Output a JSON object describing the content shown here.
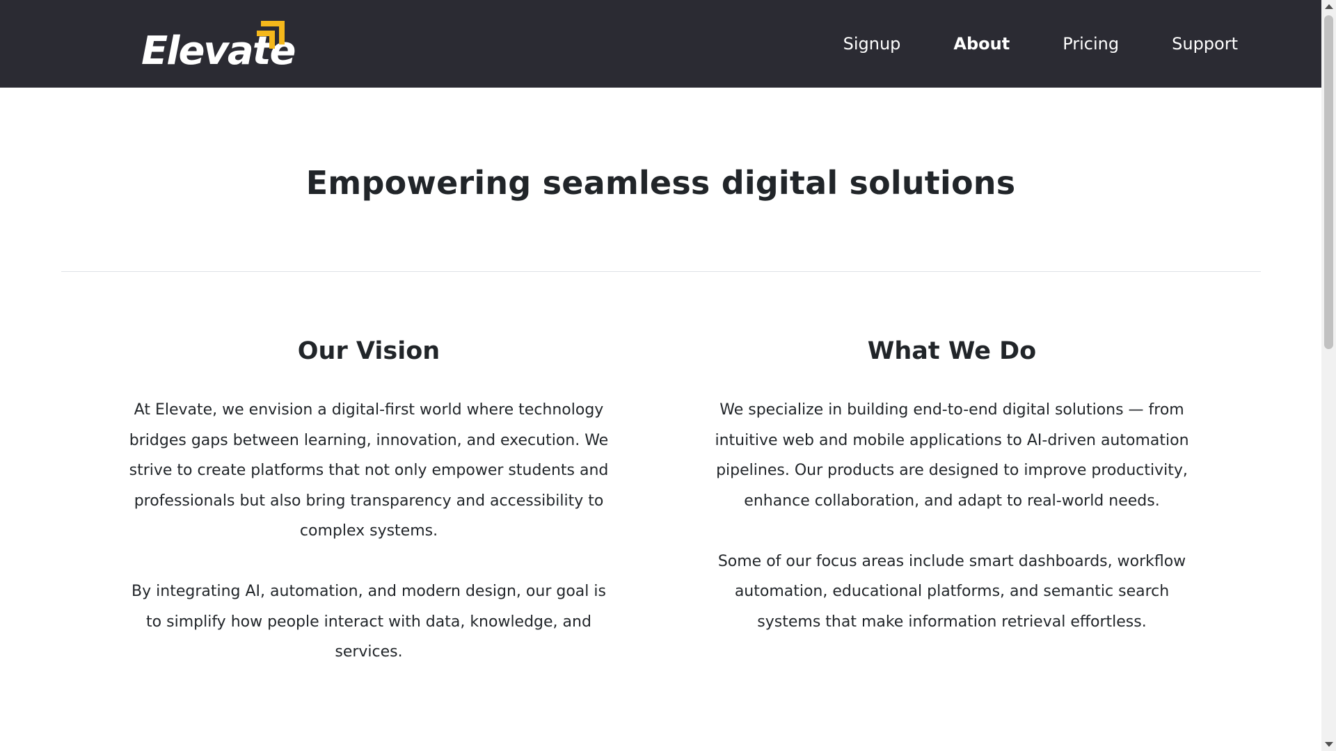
{
  "brand": {
    "name": "Elevate",
    "logo_icon": "upward-arrows-icon",
    "accent_color": "#f5b81b",
    "header_bg": "#2b2b33"
  },
  "nav": {
    "items": [
      {
        "label": "Signup",
        "active": false
      },
      {
        "label": "About",
        "active": true
      },
      {
        "label": "Pricing",
        "active": false
      },
      {
        "label": "Support",
        "active": false
      }
    ]
  },
  "hero": {
    "title": "Empowering seamless digital solutions"
  },
  "vision": {
    "title": "Our Vision",
    "paragraphs": [
      "At Elevate, we envision a digital-first world where technology bridges gaps between learning, innovation, and execution. We strive to create platforms that not only empower students and professionals but also bring transparency and accessibility to complex systems.",
      "By integrating AI, automation, and modern design, our goal is to simplify how people interact with data, knowledge, and services."
    ]
  },
  "what_we_do": {
    "title": "What We Do",
    "paragraphs": [
      "We specialize in building end-to-end digital solutions — from intuitive web and mobile applications to AI-driven automation pipelines. Our products are designed to improve productivity, enhance collaboration, and adapt to real-world needs.",
      "Some of our focus areas include smart dashboards, workflow automation, educational platforms, and semantic search systems that make information retrieval effortless."
    ]
  }
}
